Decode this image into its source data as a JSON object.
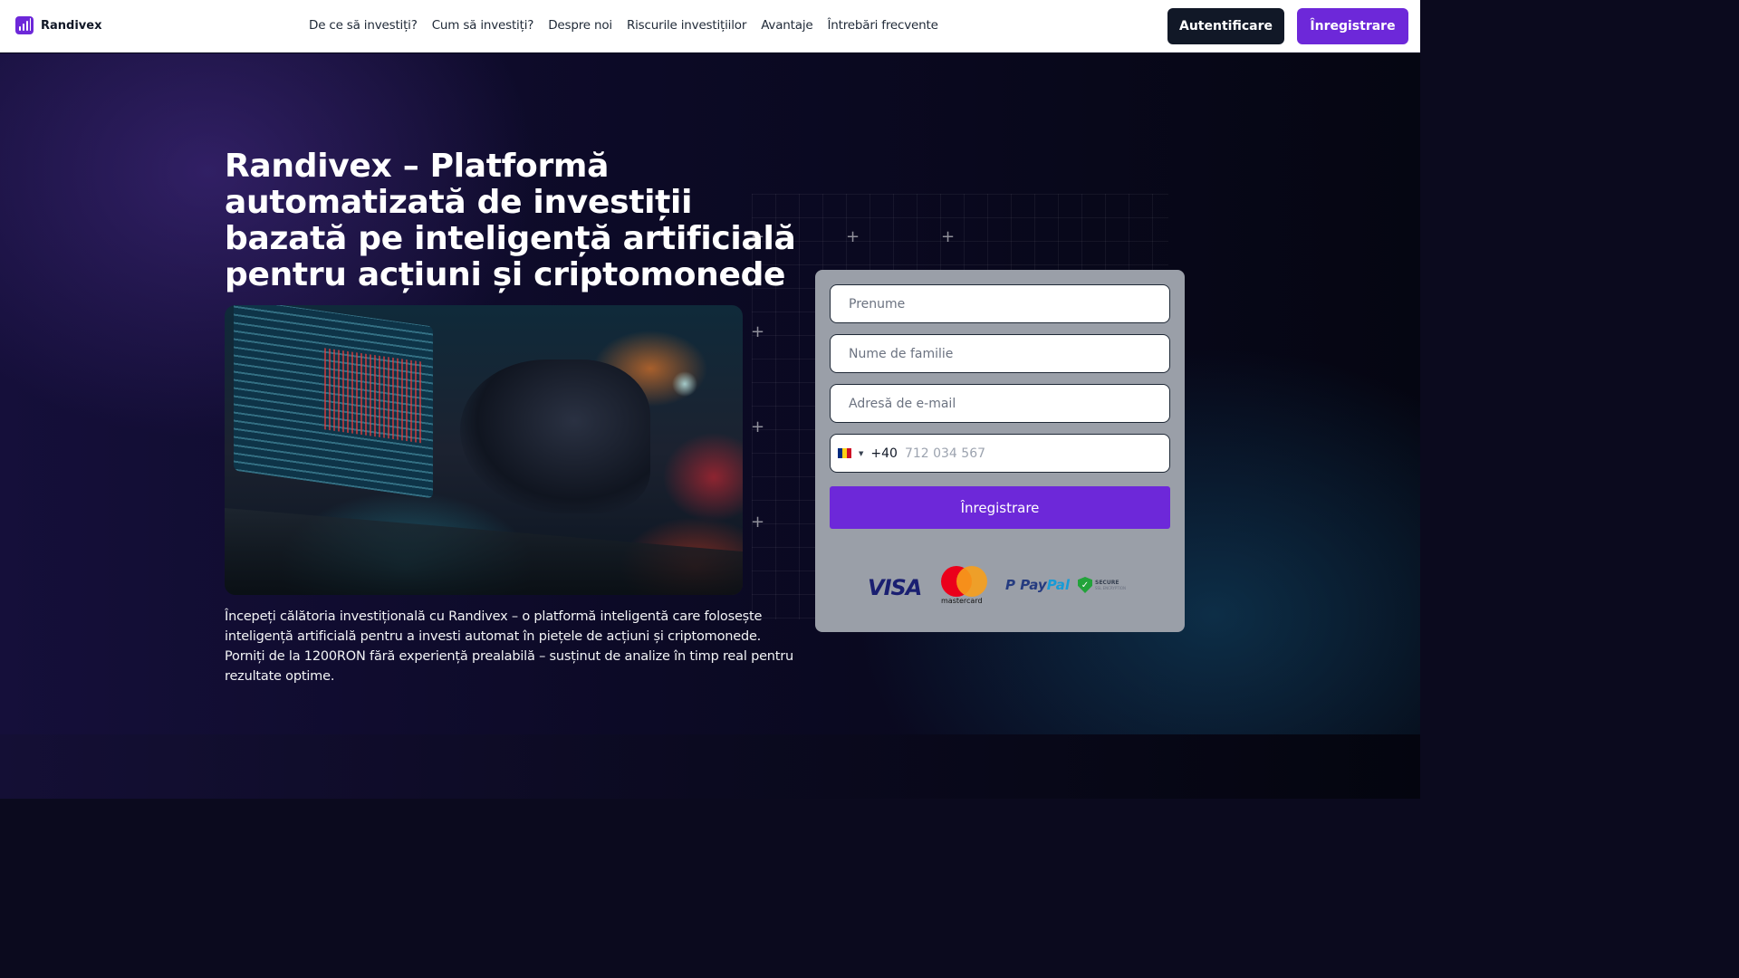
{
  "nav": {
    "brand": "Randivex",
    "menu": [
      "De ce să investiți?",
      "Cum să investiți?",
      "Despre noi",
      "Riscurile investițiilor",
      "Avantaje",
      "Întrebări frecvente"
    ],
    "login_label": "Autentificare",
    "register_label": "Înregistrare",
    "accent": "#6d28d9"
  },
  "hero": {
    "title": "Randivex – Platformă automatizată de investiții bazată pe inteligență artificială pentru acțiuni și criptomonede",
    "intro": "Începeți călătoria investițională cu Randivex – o platformă inteligentă care folosește inteligență artificială pentru a investi automat în piețele de acțiuni și criptomonede. Porniți de la 1200RON fără experiență prealabilă – susținut de analize în timp real pentru rezultate optime.",
    "image_icon": "laptop-robot-hand-image"
  },
  "form": {
    "first_name_placeholder": "Prenume",
    "last_name_placeholder": "Nume de familie",
    "email_placeholder": "Adresă de e-mail",
    "phone_flag": "romania-flag-icon",
    "phone_dial_code": "+40",
    "phone_placeholder": "712 034 567",
    "submit_label": "Înregistrare",
    "payment_logos": {
      "visa": "VISA",
      "mastercard": "mastercard",
      "paypal_pay": "Pay",
      "paypal_pal": "Pal",
      "secure": "SECURE",
      "secure_sub": "SSL ENCRYPTION"
    }
  }
}
